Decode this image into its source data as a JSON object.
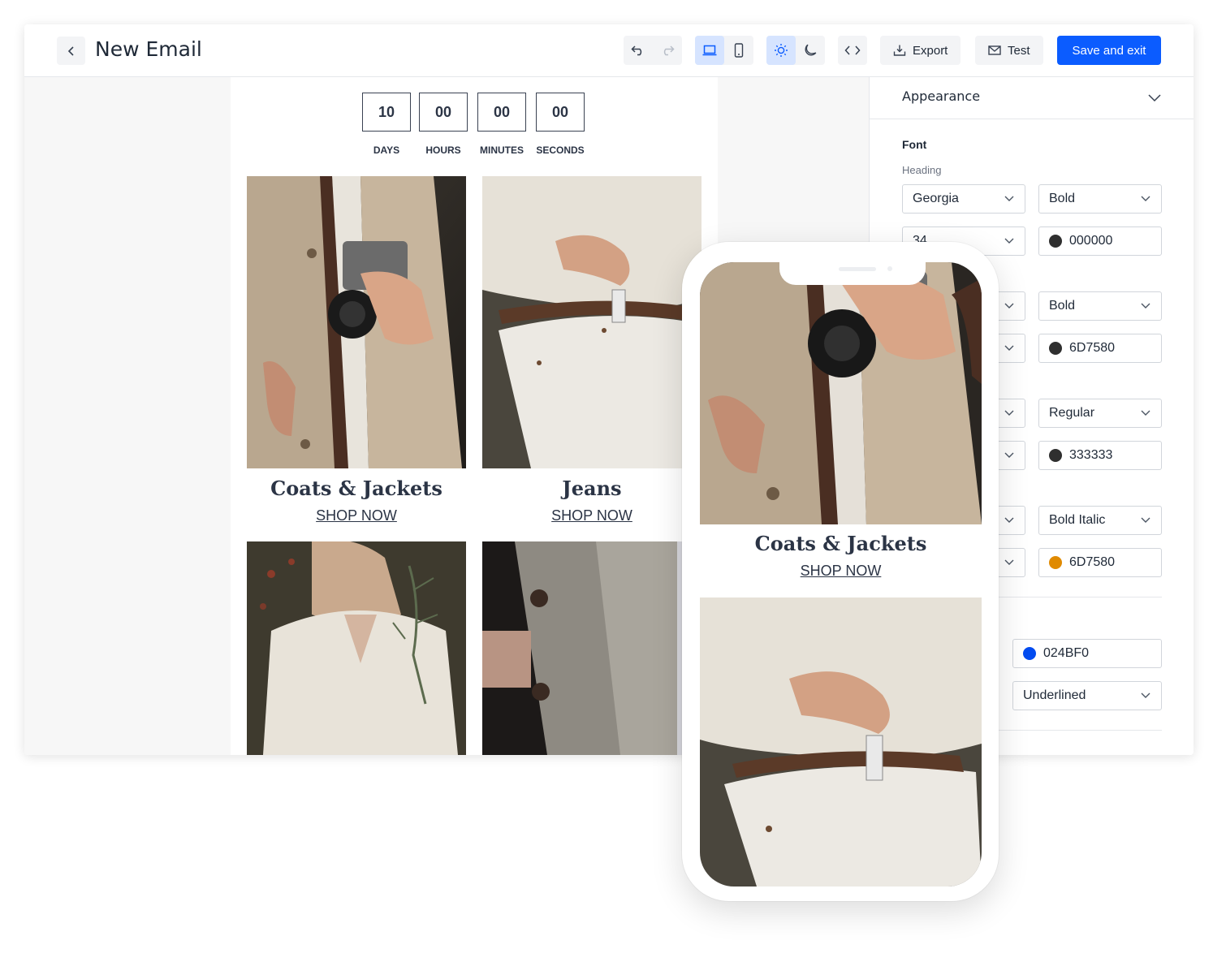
{
  "header": {
    "title": "New Email",
    "export_label": "Export",
    "test_label": "Test",
    "save_label": "Save and exit"
  },
  "email": {
    "countdown": [
      {
        "value": "10",
        "label": "DAYS"
      },
      {
        "value": "00",
        "label": "HOURS"
      },
      {
        "value": "00",
        "label": "MINUTES"
      },
      {
        "value": "00",
        "label": "SECONDS"
      }
    ],
    "products": [
      {
        "title": "Coats & Jackets",
        "link": "SHOP NOW"
      },
      {
        "title": "Jeans",
        "link": "SHOP NOW"
      }
    ]
  },
  "panel": {
    "section_title": "Appearance",
    "font_label": "Font",
    "heading_label": "Heading",
    "heading_family": "Georgia",
    "heading_weight": "Bold",
    "heading_size": "34",
    "heading_color": "000000",
    "row2_weight": "Bold",
    "row2_color": "6D7580",
    "row3_weight": "Regular",
    "row3_color": "333333",
    "row4_weight": "Bold Italic",
    "row4_color": "6D7580",
    "link_color": "024BF0",
    "link_style": "Underlined"
  },
  "mobile": {
    "product_title": "Coats & Jackets",
    "product_link": "SHOP NOW"
  },
  "colors": {
    "primary": "#0b5cff",
    "swatch_dark": "#2f2f2f",
    "swatch_orange": "#e08a00",
    "swatch_blue": "#024bf0"
  }
}
